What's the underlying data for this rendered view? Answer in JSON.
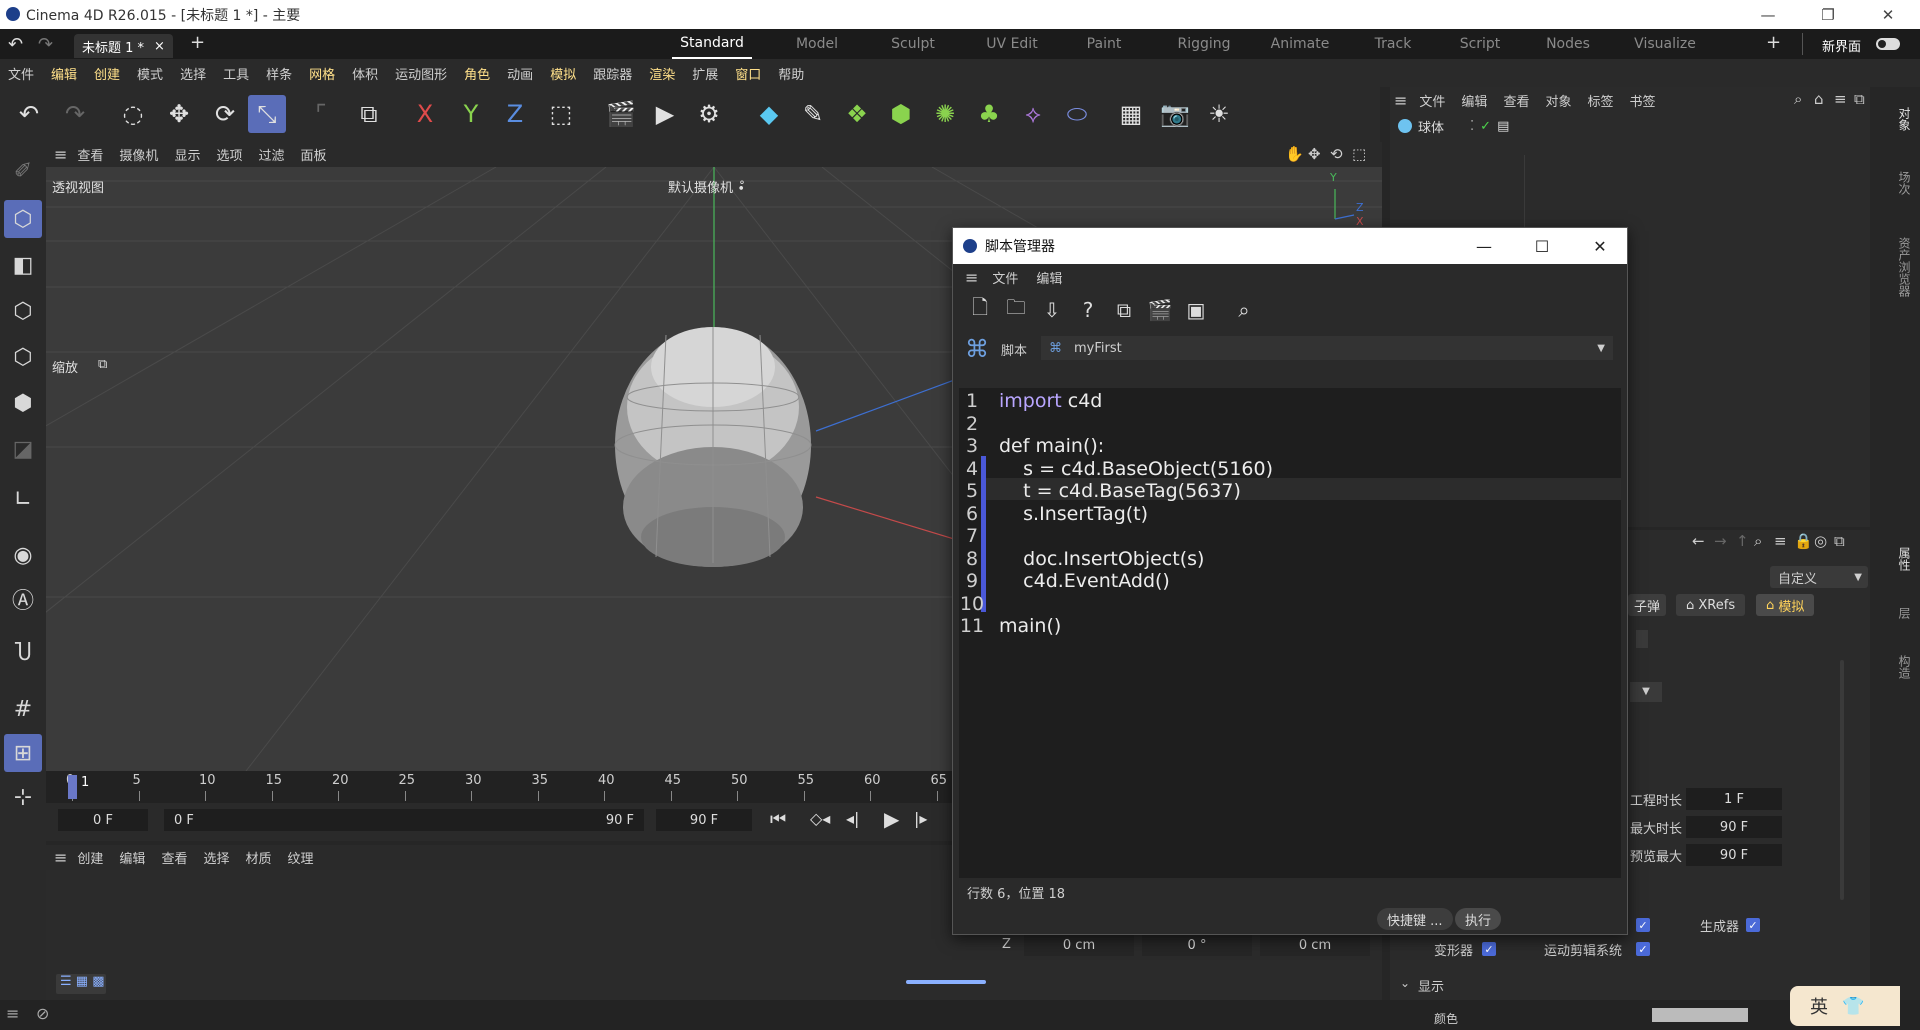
{
  "window": {
    "title": "Cinema 4D R26.015 - [未标题 1 *] - 主要",
    "min": "—",
    "max": "❐",
    "close": "✕"
  },
  "tabs": {
    "doc_tab": "未标题 1 *",
    "doc_close": "×",
    "add": "+",
    "workspaces": [
      "Standard",
      "Model",
      "Sculpt",
      "UV Edit",
      "Paint",
      "Rigging",
      "Animate",
      "Track",
      "Script",
      "Nodes",
      "Visualize"
    ],
    "ws_add": "+",
    "new_ui": "新界面"
  },
  "menu": [
    "文件",
    "编辑",
    "创建",
    "模式",
    "选择",
    "工具",
    "样条",
    "网格",
    "体积",
    "运动图形",
    "角色",
    "动画",
    "模拟",
    "跟踪器",
    "渲染",
    "扩展",
    "窗口",
    "帮助"
  ],
  "viewport_menu": [
    "查看",
    "摄像机",
    "显示",
    "选项",
    "过滤",
    "面板"
  ],
  "viewport": {
    "name": "透视视图",
    "camera": "默认摄像机 ∙̊",
    "zoom_label": "缩放",
    "axis_y": "Y",
    "axis_z": "Z",
    "axis_x": "X"
  },
  "object_manager": {
    "menu": [
      "文件",
      "编辑",
      "查看",
      "对象",
      "标签",
      "书签"
    ],
    "object_name": "球体"
  },
  "right_strip": [
    "对象",
    "场次",
    "资产浏览器",
    "属性",
    "层",
    "构造"
  ],
  "timeline": {
    "ticks": [
      "0",
      "5",
      "10",
      "15",
      "20",
      "25",
      "30",
      "35",
      "40",
      "45",
      "50",
      "55",
      "60",
      "65"
    ],
    "current": "1",
    "start": "0 F",
    "range_start": "0 F",
    "range_end": "90 F",
    "end": "90 F"
  },
  "material_menu": [
    "创建",
    "编辑",
    "查看",
    "选择",
    "材质",
    "纹理"
  ],
  "attributes": {
    "dropdown": "自定义",
    "tabs": [
      "子弹",
      "XRefs",
      "模拟"
    ],
    "rows": [
      {
        "label": "工程时长",
        "value": "1 F"
      },
      {
        "label": "最大时长",
        "value": "90 F"
      },
      {
        "label": "预览最大",
        "value": "90 F"
      }
    ],
    "coord_z": "Z",
    "coord_vals": [
      "0 cm",
      "0 °",
      "0 cm"
    ],
    "checks": [
      {
        "label": "生成器"
      },
      {
        "label": "变形器"
      },
      {
        "label": "运动剪辑系统"
      }
    ],
    "section": "显示",
    "color_label": "颜色"
  },
  "script_manager": {
    "title": "脚本管理器",
    "menu": [
      "文件",
      "编辑"
    ],
    "script_label": "脚本",
    "script_name": "myFirst",
    "lines": [
      {
        "n": "1",
        "code": "import c4d"
      },
      {
        "n": "2",
        "code": ""
      },
      {
        "n": "3",
        "code": "def main():"
      },
      {
        "n": "4",
        "code": "    s = c4d.BaseObject(5160)"
      },
      {
        "n": "5",
        "code": "    t = c4d.BaseTag(5637)"
      },
      {
        "n": "6",
        "code": "    s.InsertTag(t)"
      },
      {
        "n": "7",
        "code": ""
      },
      {
        "n": "8",
        "code": "    doc.InsertObject(s)"
      },
      {
        "n": "9",
        "code": "    c4d.EventAdd()"
      },
      {
        "n": "10",
        "code": ""
      },
      {
        "n": "11",
        "code": "main()"
      }
    ],
    "status": "行数 6，位置 18",
    "shortcut_button": "快捷键 ...",
    "execute_button": "执行"
  },
  "ime": {
    "lang": "英"
  }
}
